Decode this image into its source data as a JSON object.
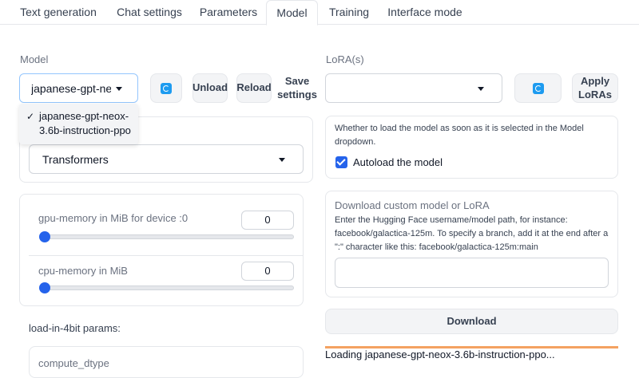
{
  "tabs": [
    {
      "label": "Text generation",
      "active": false
    },
    {
      "label": "Chat settings",
      "active": false
    },
    {
      "label": "Parameters",
      "active": false
    },
    {
      "label": "Model",
      "active": true
    },
    {
      "label": "Training",
      "active": false
    },
    {
      "label": "Interface mode",
      "active": false
    }
  ],
  "model": {
    "label": "Model",
    "selected": "japanese-gpt-neox-3.6b-instruction-ppo",
    "selected_display": "japanese-gpt-neo",
    "menu_option": "japanese-gpt-neox-3.6b-instruction-ppo",
    "menu_check": "✓",
    "unload_label": "Unload",
    "reload_label": "Reload",
    "save_label_line1": "Save",
    "save_label_line2": "settings"
  },
  "loader": {
    "selected": "Transformers"
  },
  "memory": {
    "gpu_label": "gpu-memory in MiB for device :0",
    "gpu_value": "0",
    "gpu_level": 0,
    "cpu_label": "cpu-memory in MiB",
    "cpu_value": "0",
    "cpu_level": 0
  },
  "load4bit": {
    "heading": "load-in-4bit params:",
    "compute_dtype_label": "compute_dtype"
  },
  "lora": {
    "label": "LoRA(s)",
    "selected": "",
    "apply_line1": "Apply",
    "apply_line2": "LoRAs"
  },
  "autoload": {
    "description": "Whether to load the model as soon as it is selected in the Model dropdown.",
    "checkbox_label": "Autoload the model",
    "checked": true
  },
  "download": {
    "title": "Download custom model or LoRA",
    "description": "Enter the Hugging Face username/model path, for instance: facebook/galactica-125m. To specify a branch, add it at the end after a \":\" character like this: facebook/galactica-125m:main",
    "input_value": "",
    "button_label": "Download"
  },
  "status": {
    "text": "Loading japanese-gpt-neox-3.6b-instruction-ppo..."
  },
  "colors": {
    "accent": "#2563eb",
    "refresh": "#1d9bf0",
    "progress": "#f4a261"
  }
}
